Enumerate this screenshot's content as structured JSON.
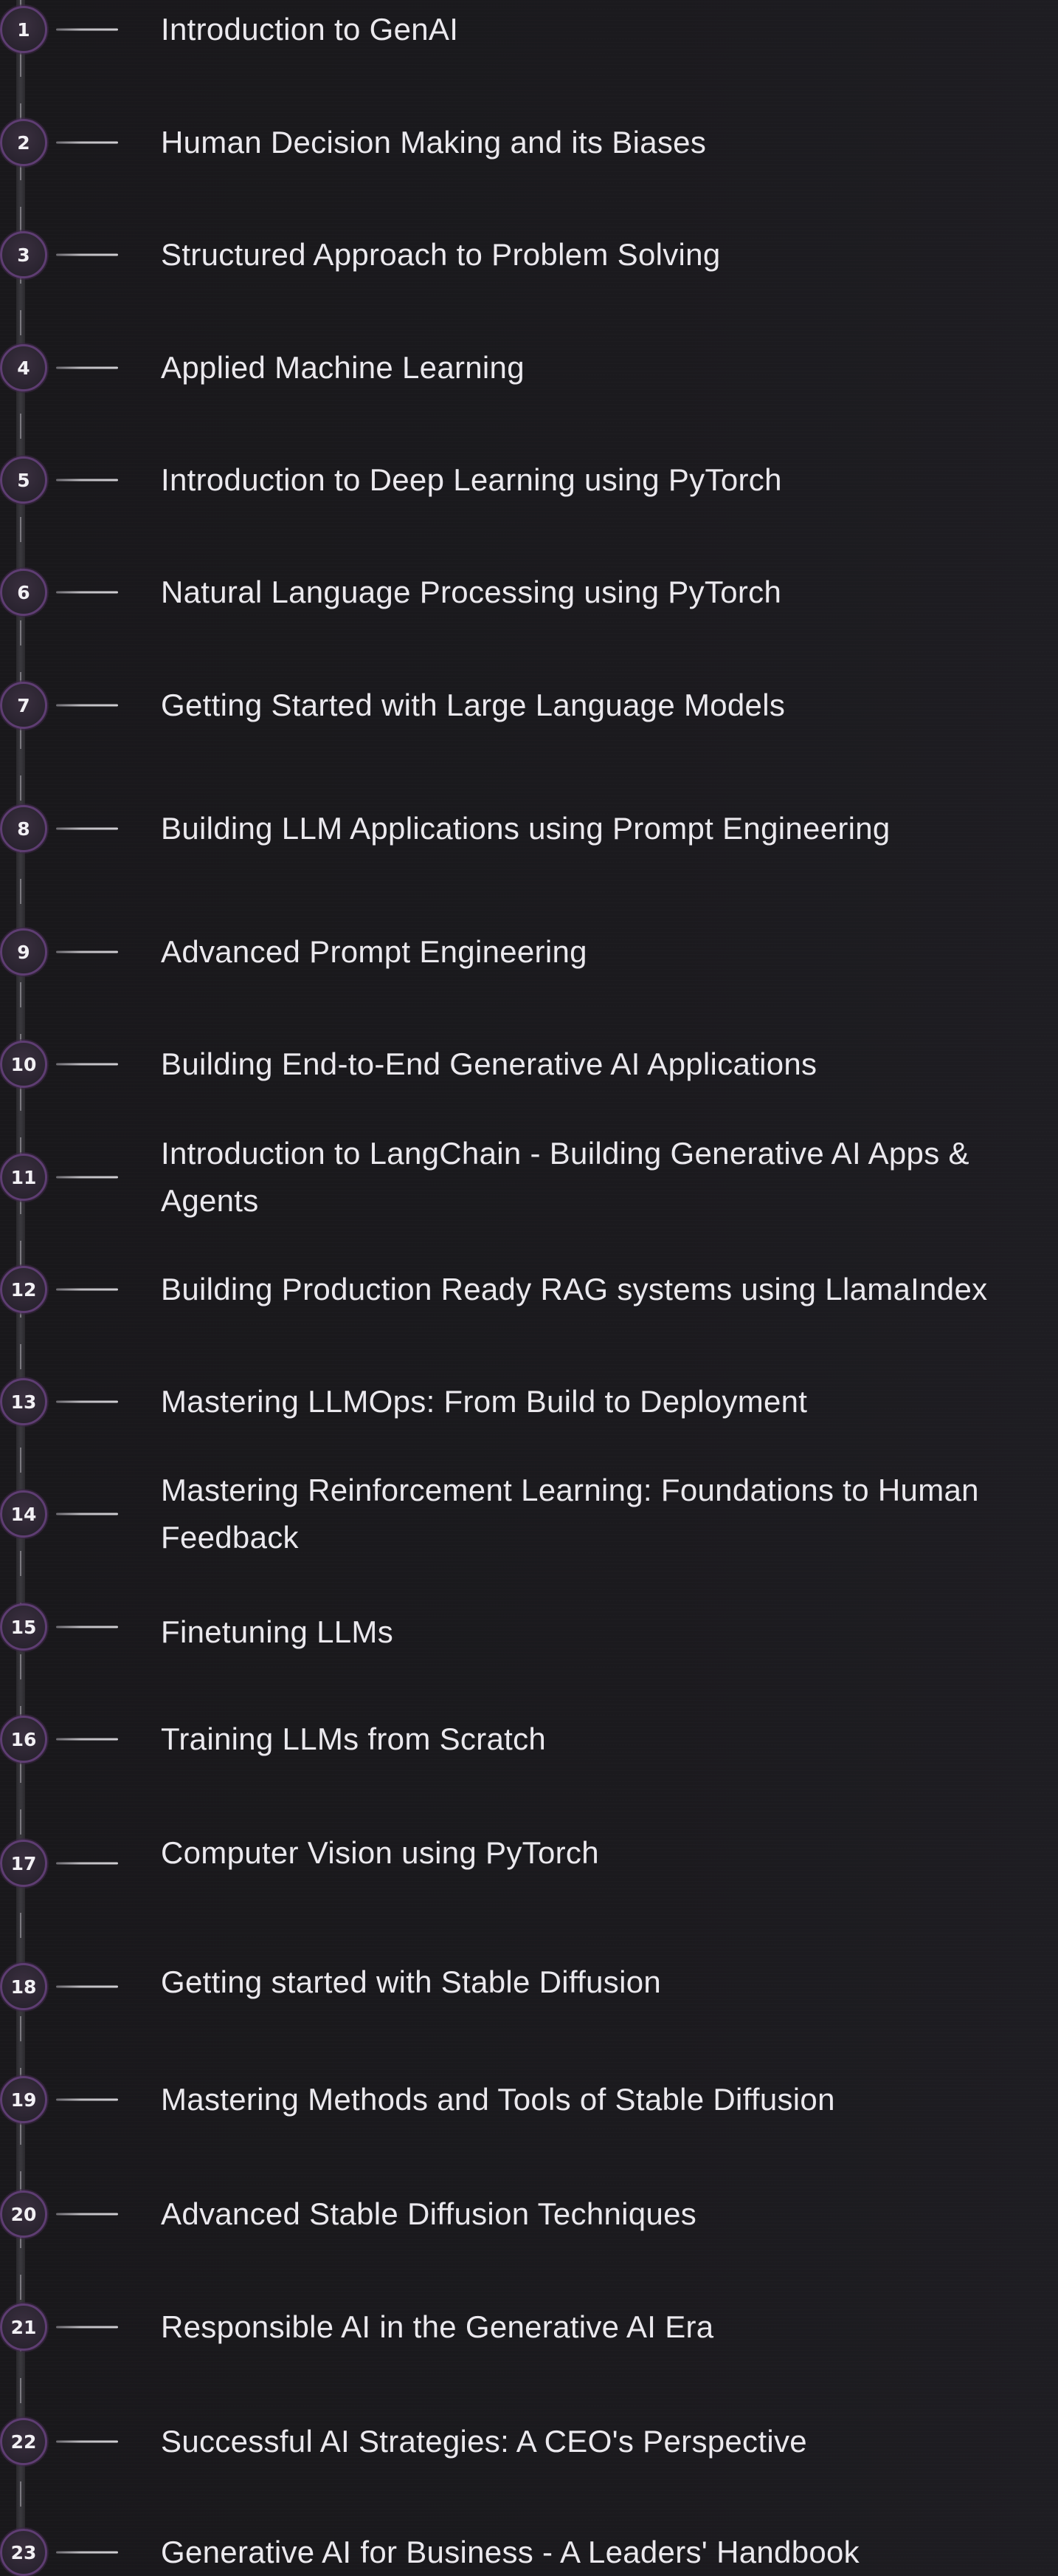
{
  "modules": [
    {
      "number": "1",
      "title": "Introduction to GenAI"
    },
    {
      "number": "2",
      "title": "Human Decision Making and its Biases"
    },
    {
      "number": "3",
      "title": "Structured Approach to Problem Solving"
    },
    {
      "number": "4",
      "title": "Applied Machine Learning"
    },
    {
      "number": "5",
      "title": "Introduction to Deep Learning using PyTorch"
    },
    {
      "number": "6",
      "title": "Natural Language Processing using PyTorch"
    },
    {
      "number": "7",
      "title": "Getting Started with Large Language Models"
    },
    {
      "number": "8",
      "title": "Building LLM Applications using Prompt Engineering"
    },
    {
      "number": "9",
      "title": "Advanced Prompt Engineering"
    },
    {
      "number": "10",
      "title": "Building End-to-End Generative AI Applications"
    },
    {
      "number": "11",
      "title": "Introduction to LangChain - Building Generative AI Apps & Agents"
    },
    {
      "number": "12",
      "title": "Building Production Ready RAG systems using LlamaIndex"
    },
    {
      "number": "13",
      "title": "Mastering LLMOps: From Build to Deployment"
    },
    {
      "number": "14",
      "title": "Mastering Reinforcement Learning: Foundations to Human Feedback"
    },
    {
      "number": "15",
      "title": "Finetuning LLMs"
    },
    {
      "number": "16",
      "title": "Training LLMs from Scratch"
    },
    {
      "number": "17",
      "title": "Computer Vision using PyTorch"
    },
    {
      "number": "18",
      "title": "Getting started with Stable Diffusion"
    },
    {
      "number": "19",
      "title": "Mastering Methods and Tools of Stable Diffusion"
    },
    {
      "number": "20",
      "title": "Advanced Stable Diffusion Techniques"
    },
    {
      "number": "21",
      "title": "Responsible AI in the Generative AI Era"
    },
    {
      "number": "22",
      "title": "Successful AI Strategies: A CEO's Perspective"
    },
    {
      "number": "23",
      "title": "Generative AI for Business - A Leaders' Handbook"
    }
  ],
  "colors": {
    "background": "#1a191c",
    "badge_border": "#5e3d72",
    "text": "#ebe9ee"
  }
}
